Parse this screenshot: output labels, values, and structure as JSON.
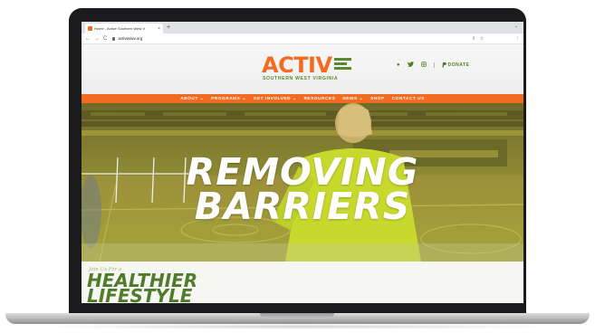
{
  "browser": {
    "tab_title": "Home - Active Southern West V",
    "tab_close": "×",
    "new_tab": "+",
    "tab_menu": "⌄",
    "back": "←",
    "forward": "→",
    "reload": "C",
    "url": "activeswv.org",
    "share_icon": "⇧",
    "star_icon": "☆",
    "menu_icon": "⋮"
  },
  "site": {
    "logo_word": "ACTIV",
    "logo_subtitle": "SOUTHERN WEST VIRGINIA",
    "colors": {
      "brand_orange": "#f26b21",
      "brand_green": "#5a8a2e"
    },
    "socials": [
      {
        "icon": "facebook-icon",
        "glyph": "●"
      },
      {
        "icon": "twitter-icon",
        "glyph": "♥"
      },
      {
        "icon": "instagram-icon",
        "glyph": "◻"
      }
    ],
    "donate_label": "DONATE",
    "nav": [
      "ABOUT ⌄",
      "PROGRAMS ⌄",
      "GET INVOLVED ⌄",
      "RESOURCES",
      "NEWS ⌄",
      "SHOP",
      "CONTACT US"
    ],
    "hero": {
      "line1": "REMOVING",
      "line2": "BARRIERS"
    },
    "section": {
      "kicker": "Join Us For a",
      "title_line1": "HEALTHIER",
      "title_line2": "LIFESTYLE"
    }
  }
}
